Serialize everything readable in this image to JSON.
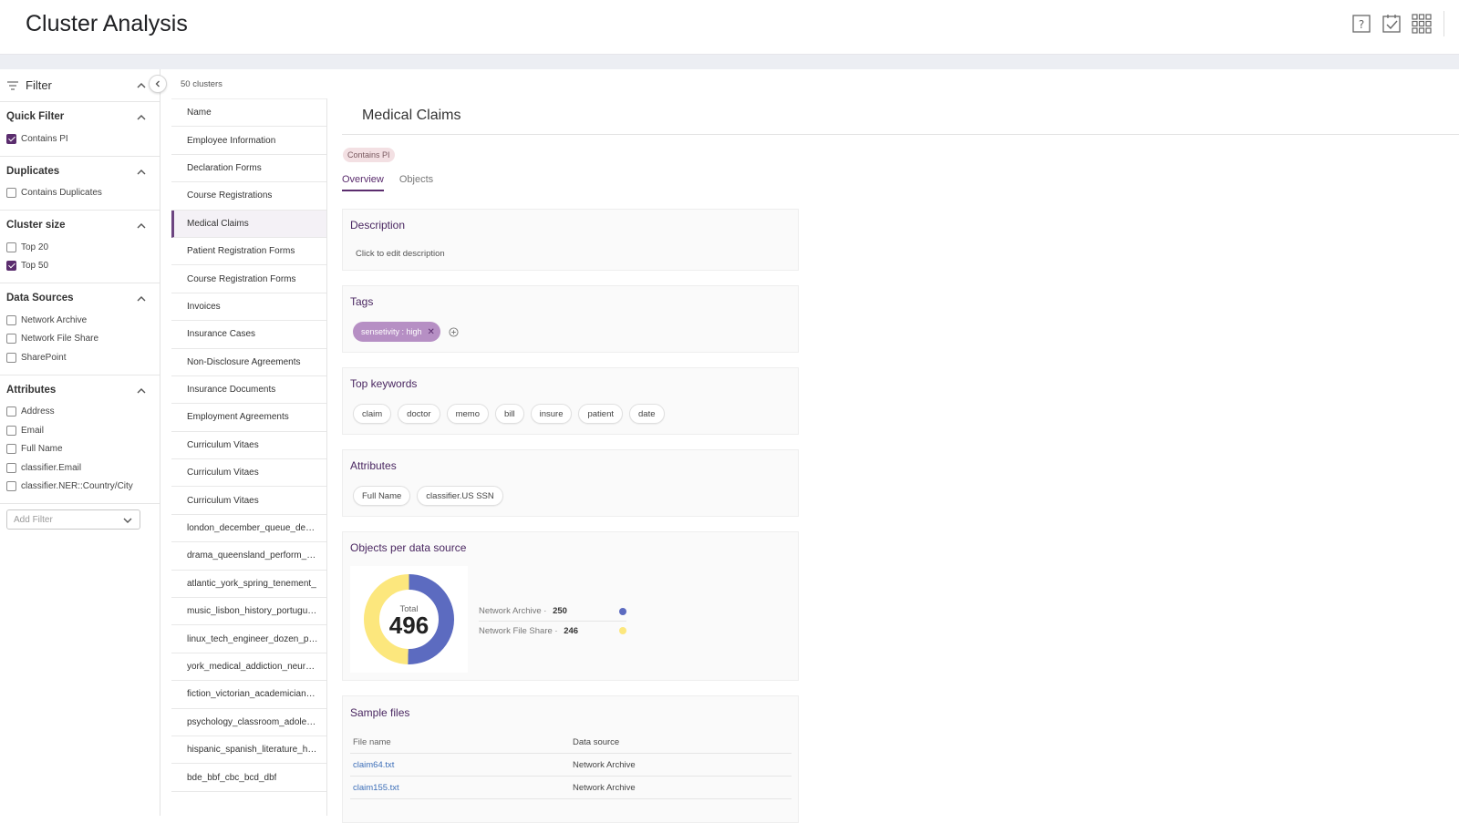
{
  "app": {
    "title": "Cluster Analysis"
  },
  "topbar": {
    "icons": [
      "help-icon",
      "task-check-icon",
      "apps-grid-icon"
    ]
  },
  "filter": {
    "header": "Filter",
    "sections": [
      {
        "title": "Quick Filter",
        "options": [
          {
            "label": "Contains PI",
            "checked": true
          }
        ]
      },
      {
        "title": "Duplicates",
        "options": [
          {
            "label": "Contains Duplicates",
            "checked": false
          }
        ]
      },
      {
        "title": "Cluster size",
        "options": [
          {
            "label": "Top 20",
            "checked": false
          },
          {
            "label": "Top 50",
            "checked": true
          }
        ]
      },
      {
        "title": "Data Sources",
        "options": [
          {
            "label": "Network Archive",
            "checked": false
          },
          {
            "label": "Network File Share",
            "checked": false
          },
          {
            "label": "SharePoint",
            "checked": false
          }
        ]
      },
      {
        "title": "Attributes",
        "options": [
          {
            "label": "Address",
            "checked": false
          },
          {
            "label": "Email",
            "checked": false
          },
          {
            "label": "Full Name",
            "checked": false
          },
          {
            "label": "classifier.Email",
            "checked": false
          },
          {
            "label": "classifier.NER::Country/City",
            "checked": false
          }
        ]
      }
    ],
    "add_filter_placeholder": "Add Filter"
  },
  "clusters": {
    "count_label": "50 clusters",
    "column_header": "Name",
    "items": [
      "Employee Information",
      "Declaration Forms",
      "Course Registrations",
      "Medical Claims",
      "Patient Registration Forms",
      "Course Registration Forms",
      "Invoices",
      "Insurance Cases",
      "Non-Disclosure Agreements",
      "Insurance Documents",
      "Employment Agreements",
      "Curriculum Vitaes",
      "Curriculum Vitaes",
      "Curriculum Vitaes",
      "london_december_queue_design",
      "drama_queensland_perform_scene",
      "atlantic_york_spring_tenement_",
      "music_lisbon_history_portuguese",
      "linux_tech_engineer_dozen_project",
      "york_medical_addiction_neurology",
      "fiction_victorian_academician_drama",
      "psychology_classroom_adolescent",
      "hispanic_spanish_literature_house",
      "bde_bbf_cbc_bcd_dbf"
    ],
    "active_index": 3
  },
  "detail": {
    "title": "Medical Claims",
    "badge": "Contains PI",
    "tabs": [
      "Overview",
      "Objects"
    ],
    "description": {
      "title": "Description",
      "text": "Click to edit description"
    },
    "tags": {
      "title": "Tags",
      "items": [
        "sensetivity : high"
      ]
    },
    "keywords": {
      "title": "Top keywords",
      "items": [
        "claim",
        "doctor",
        "memo",
        "bill",
        "insure",
        "patient",
        "date"
      ]
    },
    "attributes": {
      "title": "Attributes",
      "items": [
        "Full Name",
        "classifier.US SSN"
      ]
    },
    "objects_per_source": {
      "title": "Objects per data source",
      "total_label": "Total",
      "total": "496",
      "sources": [
        {
          "name": "Network Archive",
          "value": 250,
          "value_text": "250",
          "color": "#5c6bc0"
        },
        {
          "name": "Network File Share",
          "value": 246,
          "value_text": "246",
          "color": "#fce77d"
        }
      ]
    },
    "sample_files": {
      "title": "Sample files",
      "headers": [
        "File name",
        "Data source"
      ],
      "rows": [
        {
          "file": "claim64.txt",
          "source": "Network Archive"
        },
        {
          "file": "claim155.txt",
          "source": "Network Archive"
        }
      ]
    }
  },
  "colors": {
    "accent": "#5b2d6e",
    "tag": "#b68fc4",
    "archive": "#5c6bc0",
    "fileshare": "#fce77d",
    "link": "#3d6fb8"
  }
}
